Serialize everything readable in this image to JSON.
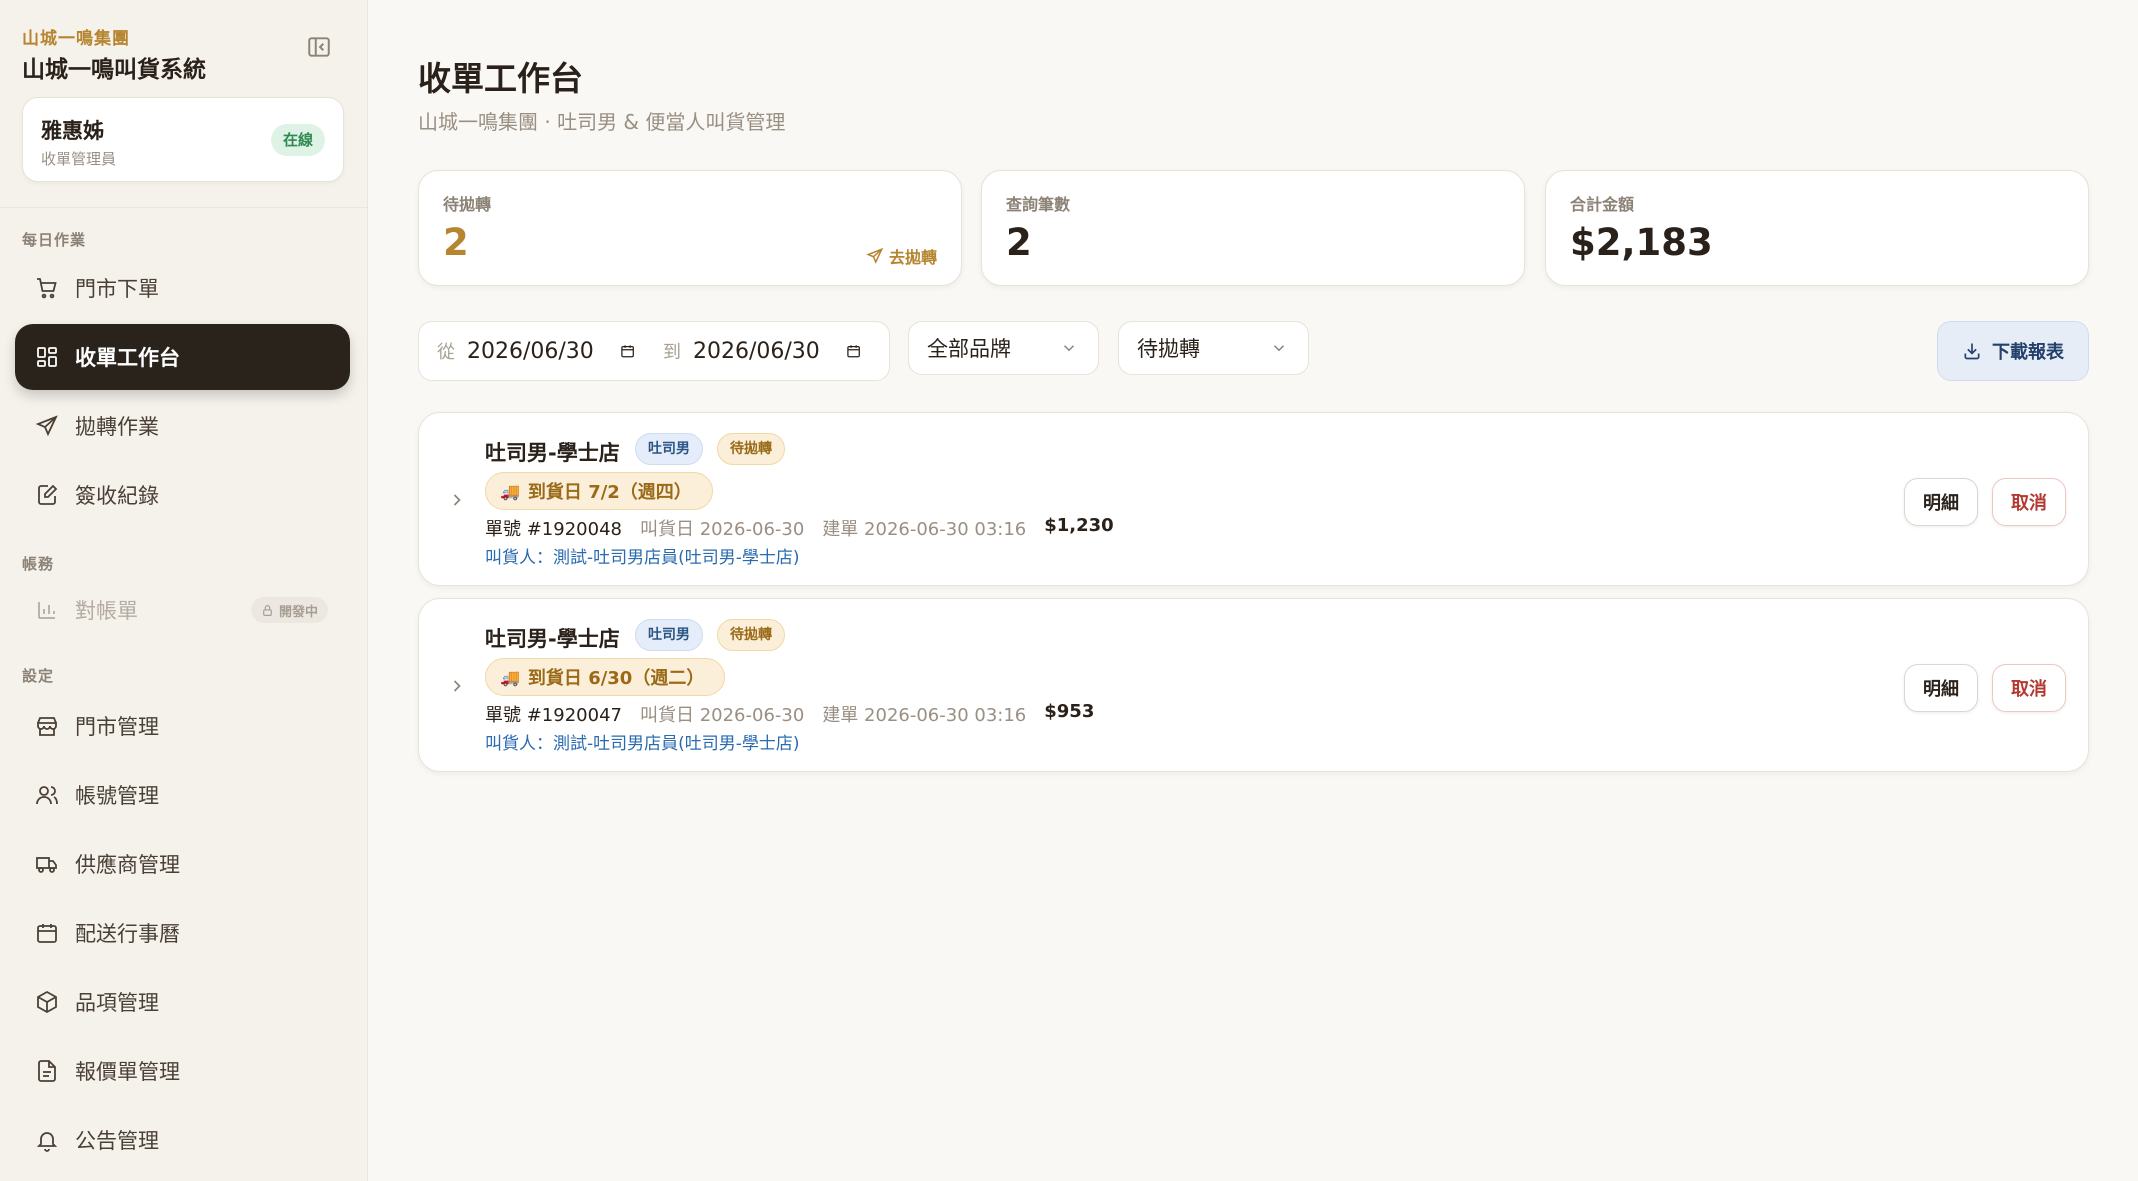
{
  "sidebar": {
    "group_name": "山城一鳴集團",
    "app_title": "山城一鳴叫貨系統",
    "user": {
      "name": "雅惠姊",
      "role": "收單管理員",
      "status": "在線"
    },
    "sections": {
      "daily": "每日作業",
      "accounts": "帳務",
      "settings": "設定"
    },
    "items": [
      {
        "label": "門市下單",
        "icon": "cart-icon"
      },
      {
        "label": "收單工作台",
        "icon": "dashboard-icon",
        "active": true
      },
      {
        "label": "拋轉作業",
        "icon": "send-icon"
      },
      {
        "label": "簽收紀錄",
        "icon": "edit-doc-icon"
      },
      {
        "label": "對帳單",
        "icon": "bar-chart-icon",
        "disabled": true,
        "badge": "開發中"
      },
      {
        "label": "門市管理",
        "icon": "store-icon"
      },
      {
        "label": "帳號管理",
        "icon": "users-icon"
      },
      {
        "label": "供應商管理",
        "icon": "truck-icon"
      },
      {
        "label": "配送行事曆",
        "icon": "calendar-icon"
      },
      {
        "label": "品項管理",
        "icon": "box-icon"
      },
      {
        "label": "報價單管理",
        "icon": "file-icon"
      },
      {
        "label": "公告管理",
        "icon": "bell-icon"
      }
    ]
  },
  "main": {
    "title": "收單工作台",
    "subtitle": "山城一鳴集團 · 吐司男 & 便當人叫貨管理",
    "stats": [
      {
        "label": "待拋轉",
        "value": "2",
        "link": "去拋轉"
      },
      {
        "label": "查詢筆數",
        "value": "2"
      },
      {
        "label": "合計金額",
        "value": "$2,183"
      }
    ],
    "filters": {
      "from_label": "從",
      "from_date": "2026/06/30",
      "to_label": "到",
      "to_date": "2026/06/30",
      "brand": "全部品牌",
      "status": "待拋轉",
      "download": "下載報表"
    },
    "orders": [
      {
        "store": "吐司男-學士店",
        "brand_tag": "吐司男",
        "status_tag": "待拋轉",
        "delivery": "到貨日 7/2（週四）",
        "order_no": "單號 #1920048",
        "order_date": "叫貨日 2026-06-30",
        "created": "建單 2026-06-30 03:16",
        "amount": "$1,230",
        "orderer": "叫貨人：測試-吐司男店員(吐司男-學士店)",
        "detail_btn": "明細",
        "cancel_btn": "取消"
      },
      {
        "store": "吐司男-學士店",
        "brand_tag": "吐司男",
        "status_tag": "待拋轉",
        "delivery": "到貨日 6/30（週二）",
        "order_no": "單號 #1920047",
        "order_date": "叫貨日 2026-06-30",
        "created": "建單 2026-06-30 03:16",
        "amount": "$953",
        "orderer": "叫貨人：測試-吐司男店員(吐司男-學士店)",
        "detail_btn": "明細",
        "cancel_btn": "取消"
      }
    ]
  },
  "colors": {
    "accent_gold": "#b5852f",
    "active_nav": "#2a231c",
    "link_blue": "#2a6bb0",
    "cancel_red": "#b23a30",
    "online_green": "#2f8a52"
  }
}
